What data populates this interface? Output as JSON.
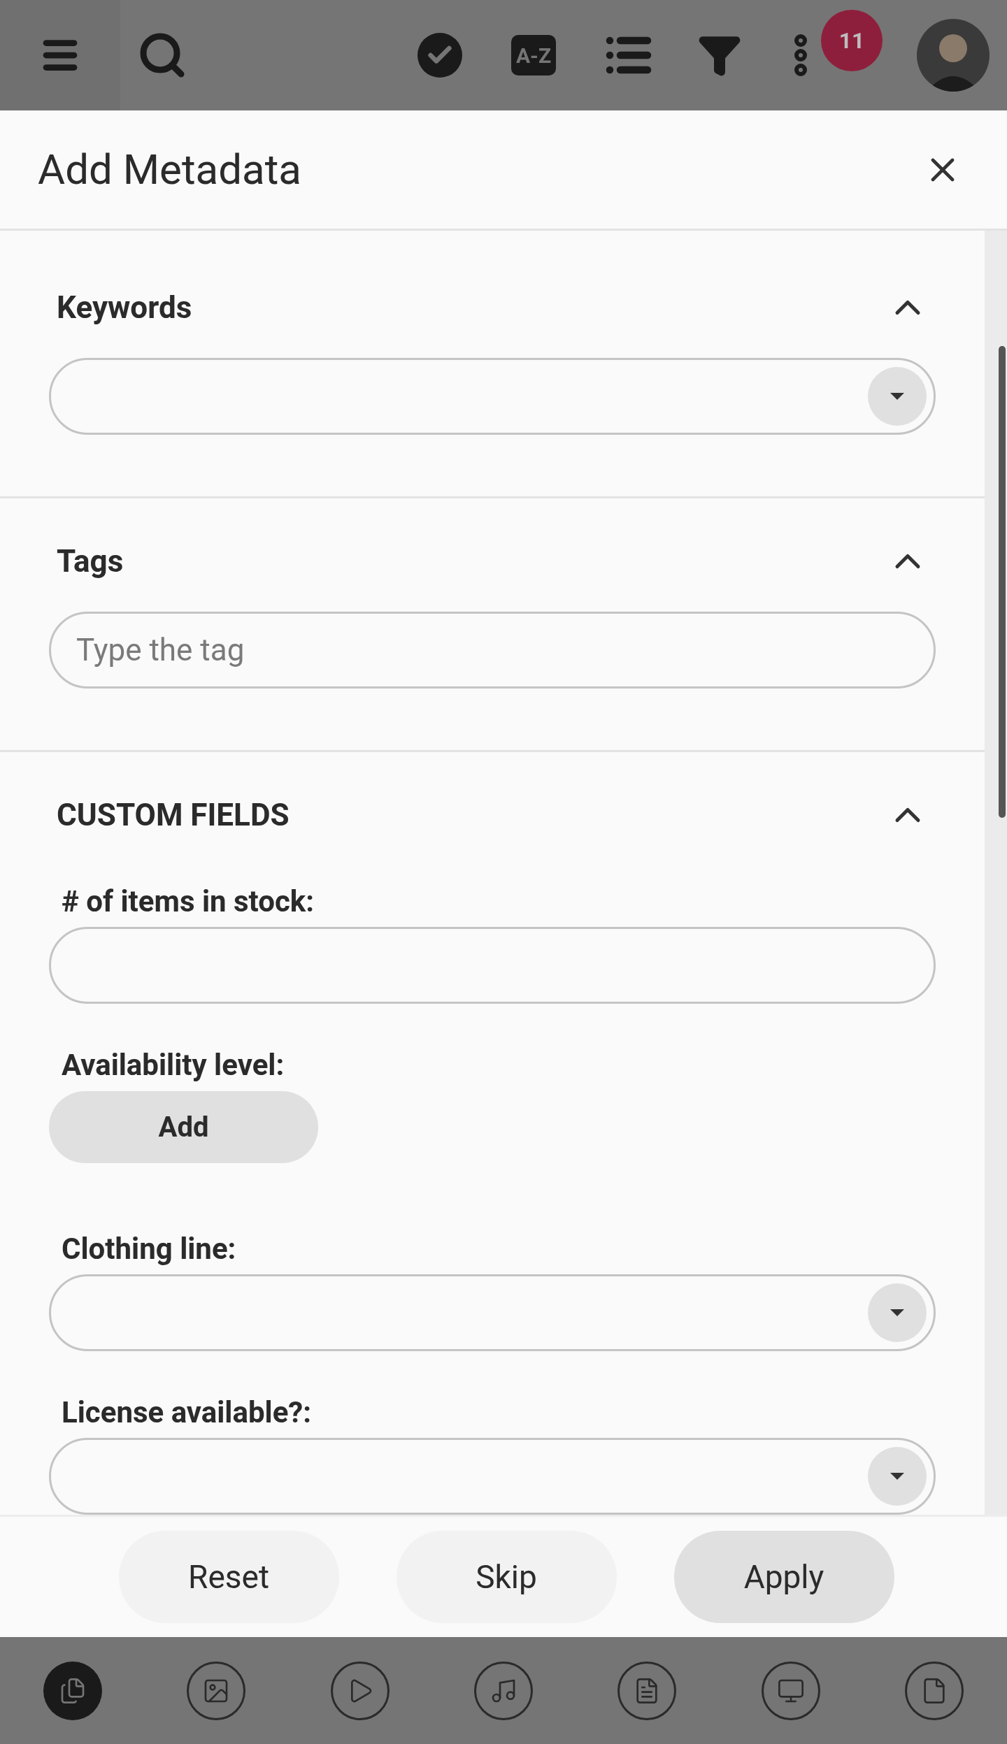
{
  "top_bar": {
    "sort_label": "A-Z",
    "notification_count": "11"
  },
  "dialog": {
    "title": "Add Metadata",
    "sections": [
      {
        "title": "Keywords",
        "expanded": true,
        "fields": [
          {
            "kind": "dropdown"
          }
        ]
      },
      {
        "title": "Tags",
        "expanded": true,
        "fields": [
          {
            "kind": "text",
            "placeholder": "Type the tag"
          }
        ]
      },
      {
        "title": "CUSTOM FIELDS",
        "expanded": true,
        "fields": [
          {
            "kind": "text",
            "label": "# of items in stock:"
          },
          {
            "kind": "button",
            "label": "Availability level:",
            "button": "Add"
          },
          {
            "kind": "dropdown",
            "label": "Clothing line:"
          },
          {
            "kind": "dropdown",
            "label": "License available?:"
          }
        ]
      }
    ],
    "buttons": [
      {
        "label": "Reset",
        "primary": false
      },
      {
        "label": "Skip",
        "primary": false
      },
      {
        "label": "Apply",
        "primary": true
      }
    ]
  },
  "bottom_nav": [
    {
      "kind": "files",
      "selected": true
    },
    {
      "kind": "image",
      "selected": false
    },
    {
      "kind": "video",
      "selected": false
    },
    {
      "kind": "audio",
      "selected": false
    },
    {
      "kind": "document",
      "selected": false
    },
    {
      "kind": "presentation",
      "selected": false
    },
    {
      "kind": "file",
      "selected": false
    }
  ]
}
